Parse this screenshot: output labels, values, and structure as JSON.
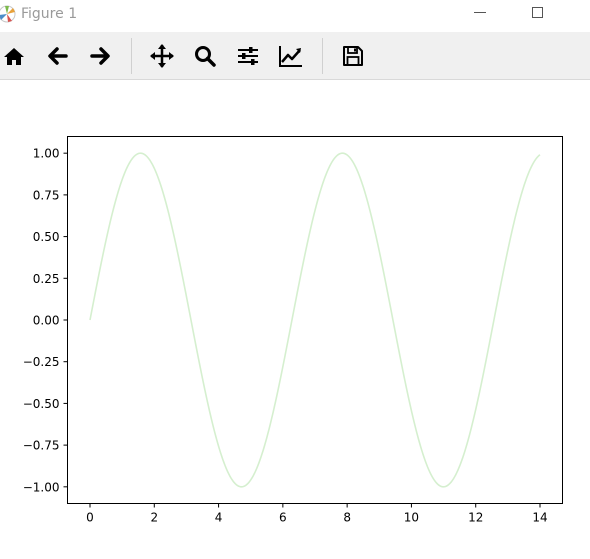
{
  "window": {
    "title": "Figure 1"
  },
  "toolbar": {
    "buttons": [
      {
        "name": "home",
        "icon": "home-icon"
      },
      {
        "name": "back",
        "icon": "arrow-left-icon"
      },
      {
        "name": "forward",
        "icon": "arrow-right-icon"
      },
      {
        "name": "pan",
        "icon": "move-icon"
      },
      {
        "name": "zoom",
        "icon": "search-icon"
      },
      {
        "name": "configure-subplots",
        "icon": "sliders-icon"
      },
      {
        "name": "edit-axes",
        "icon": "line-chart-icon"
      },
      {
        "name": "save",
        "icon": "save-icon"
      }
    ]
  },
  "chart_data": {
    "type": "line",
    "title": "",
    "xlabel": "",
    "ylabel": "",
    "xlim": [
      -0.7,
      14.7
    ],
    "ylim": [
      -1.1,
      1.1
    ],
    "xticks": [
      0,
      2,
      4,
      6,
      8,
      10,
      12,
      14
    ],
    "xtick_labels": [
      "0",
      "2",
      "4",
      "6",
      "8",
      "10",
      "12",
      "14"
    ],
    "yticks": [
      1.0,
      0.75,
      0.5,
      0.25,
      0.0,
      -0.25,
      -0.5,
      -0.75,
      -1.0
    ],
    "ytick_labels": [
      "1.00",
      "0.75",
      "0.50",
      "0.25",
      "0.00",
      "−0.25",
      "−0.50",
      "−0.75",
      "−1.00"
    ],
    "grid": false,
    "series": [
      {
        "function": "sin(x)",
        "color": "#d5efcf",
        "x": [
          0.0,
          0.5,
          1.0,
          1.5,
          2.0,
          2.5,
          3.0,
          3.5,
          4.0,
          4.5,
          5.0,
          5.5,
          6.0,
          6.5,
          7.0,
          7.5,
          8.0,
          8.5,
          9.0,
          9.5,
          10.0,
          10.5,
          11.0,
          11.5,
          12.0,
          12.5,
          13.0,
          13.5,
          14.0
        ],
        "y": [
          0.0,
          0.479,
          0.841,
          0.997,
          0.909,
          0.598,
          0.141,
          -0.351,
          -0.757,
          -0.978,
          -0.959,
          -0.706,
          -0.279,
          0.215,
          0.657,
          0.938,
          0.989,
          0.798,
          0.412,
          -0.075,
          -0.544,
          -0.88,
          -1.0,
          -0.875,
          -0.537,
          -0.066,
          0.42,
          0.804,
          0.991
        ]
      }
    ]
  }
}
